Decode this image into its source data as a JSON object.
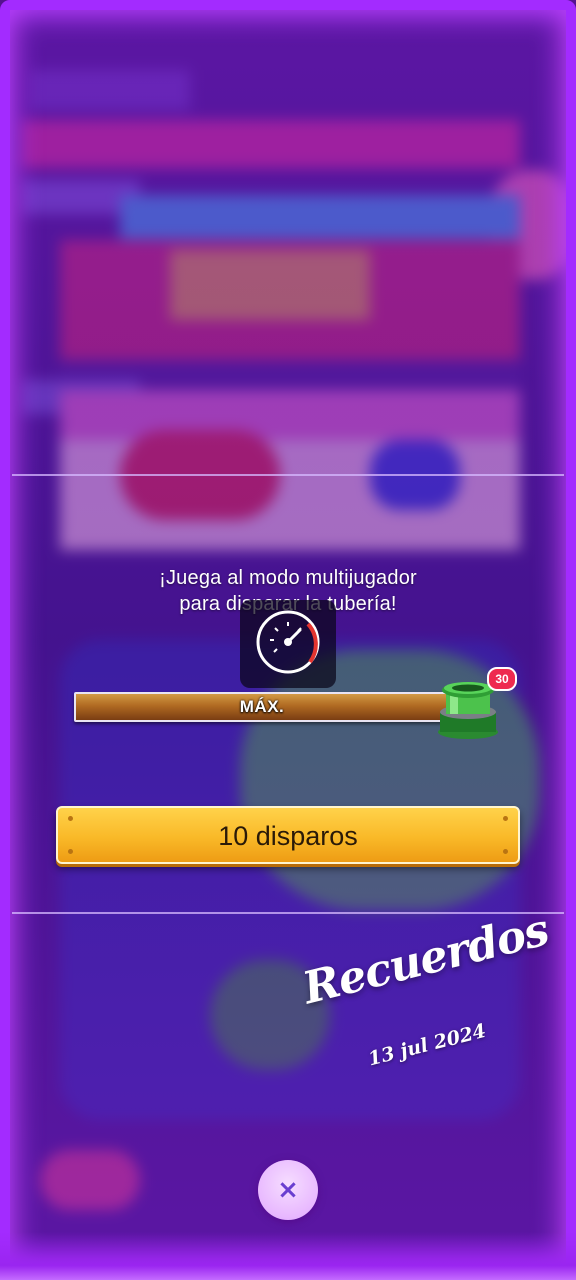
{
  "prompt": {
    "line1": "¡Juega al modo multijugador",
    "line2": "para disparar la tubería!"
  },
  "power_meter": {
    "label": "MÁX.",
    "level": 1.0,
    "fill_color": "#b06a22"
  },
  "pipe_reward": {
    "icon": "green-pipe-icon",
    "badge_count": "30",
    "badge_color": "#ee2a4f"
  },
  "gauge": {
    "icon": "speedometer-icon",
    "accent": "#e4342f"
  },
  "shots_button": {
    "label": "10 disparos",
    "color": "#f9b928"
  },
  "overlay": {
    "title": "Recuerdos",
    "date": "13 jul 2024"
  },
  "close_button": {
    "icon": "close-icon",
    "glyph": "×"
  },
  "theme": {
    "frame_color": "#a32bff",
    "background": "#2a0f4a"
  }
}
